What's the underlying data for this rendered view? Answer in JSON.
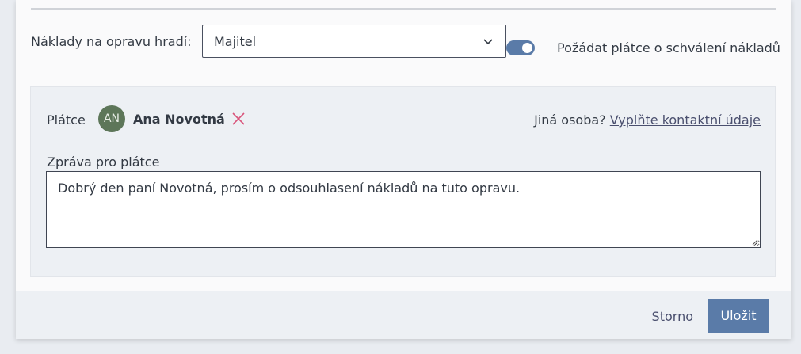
{
  "cost": {
    "label": "Náklady na opravu hradí:",
    "selected": "Majitel"
  },
  "approval": {
    "toggle_on": true,
    "label": "Požádat plátce o schválení nákladů"
  },
  "payer": {
    "label": "Plátce",
    "avatar_initials": "AN",
    "name": "Ana Novotná",
    "other_prefix": "Jiná osoba?",
    "other_link": "Vyplňte kontaktní údaje"
  },
  "message": {
    "label": "Zpráva pro plátce",
    "value": "Dobrý den paní Novotná, prosím o odsouhlasení nákladů na tuto opravu."
  },
  "footer": {
    "cancel_label": "Storno",
    "save_label": "Uložit"
  },
  "colors": {
    "accent": "#5a7ba8",
    "avatar": "#5d7659",
    "remove": "#d9537a"
  }
}
